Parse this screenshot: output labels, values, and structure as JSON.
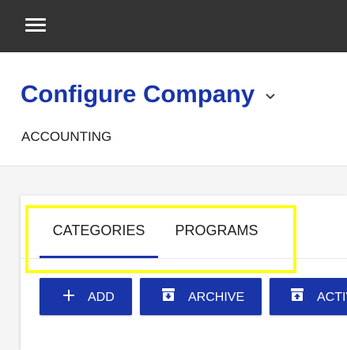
{
  "topbar": {
    "menu_icon": "hamburger-menu-icon",
    "background": "#333333"
  },
  "header": {
    "title": "Configure Company",
    "title_chevron_icon": "chevron-down-icon",
    "subtitle": "ACCOUNTING"
  },
  "tabs": [
    {
      "label": "CATEGORIES",
      "active": true
    },
    {
      "label": "PROGRAMS",
      "active": false
    }
  ],
  "actions": {
    "add": {
      "label": "ADD",
      "icon": "plus-icon"
    },
    "archive": {
      "label": "ARCHIVE",
      "icon": "archive-box-down-icon"
    },
    "activate": {
      "label": "ACTIVATE",
      "icon": "archive-box-up-icon"
    }
  },
  "colors": {
    "brand": "#1a35a8",
    "highlight": "#fdfd1a",
    "topbar": "#333333",
    "page_background": "#f5f5f5"
  }
}
